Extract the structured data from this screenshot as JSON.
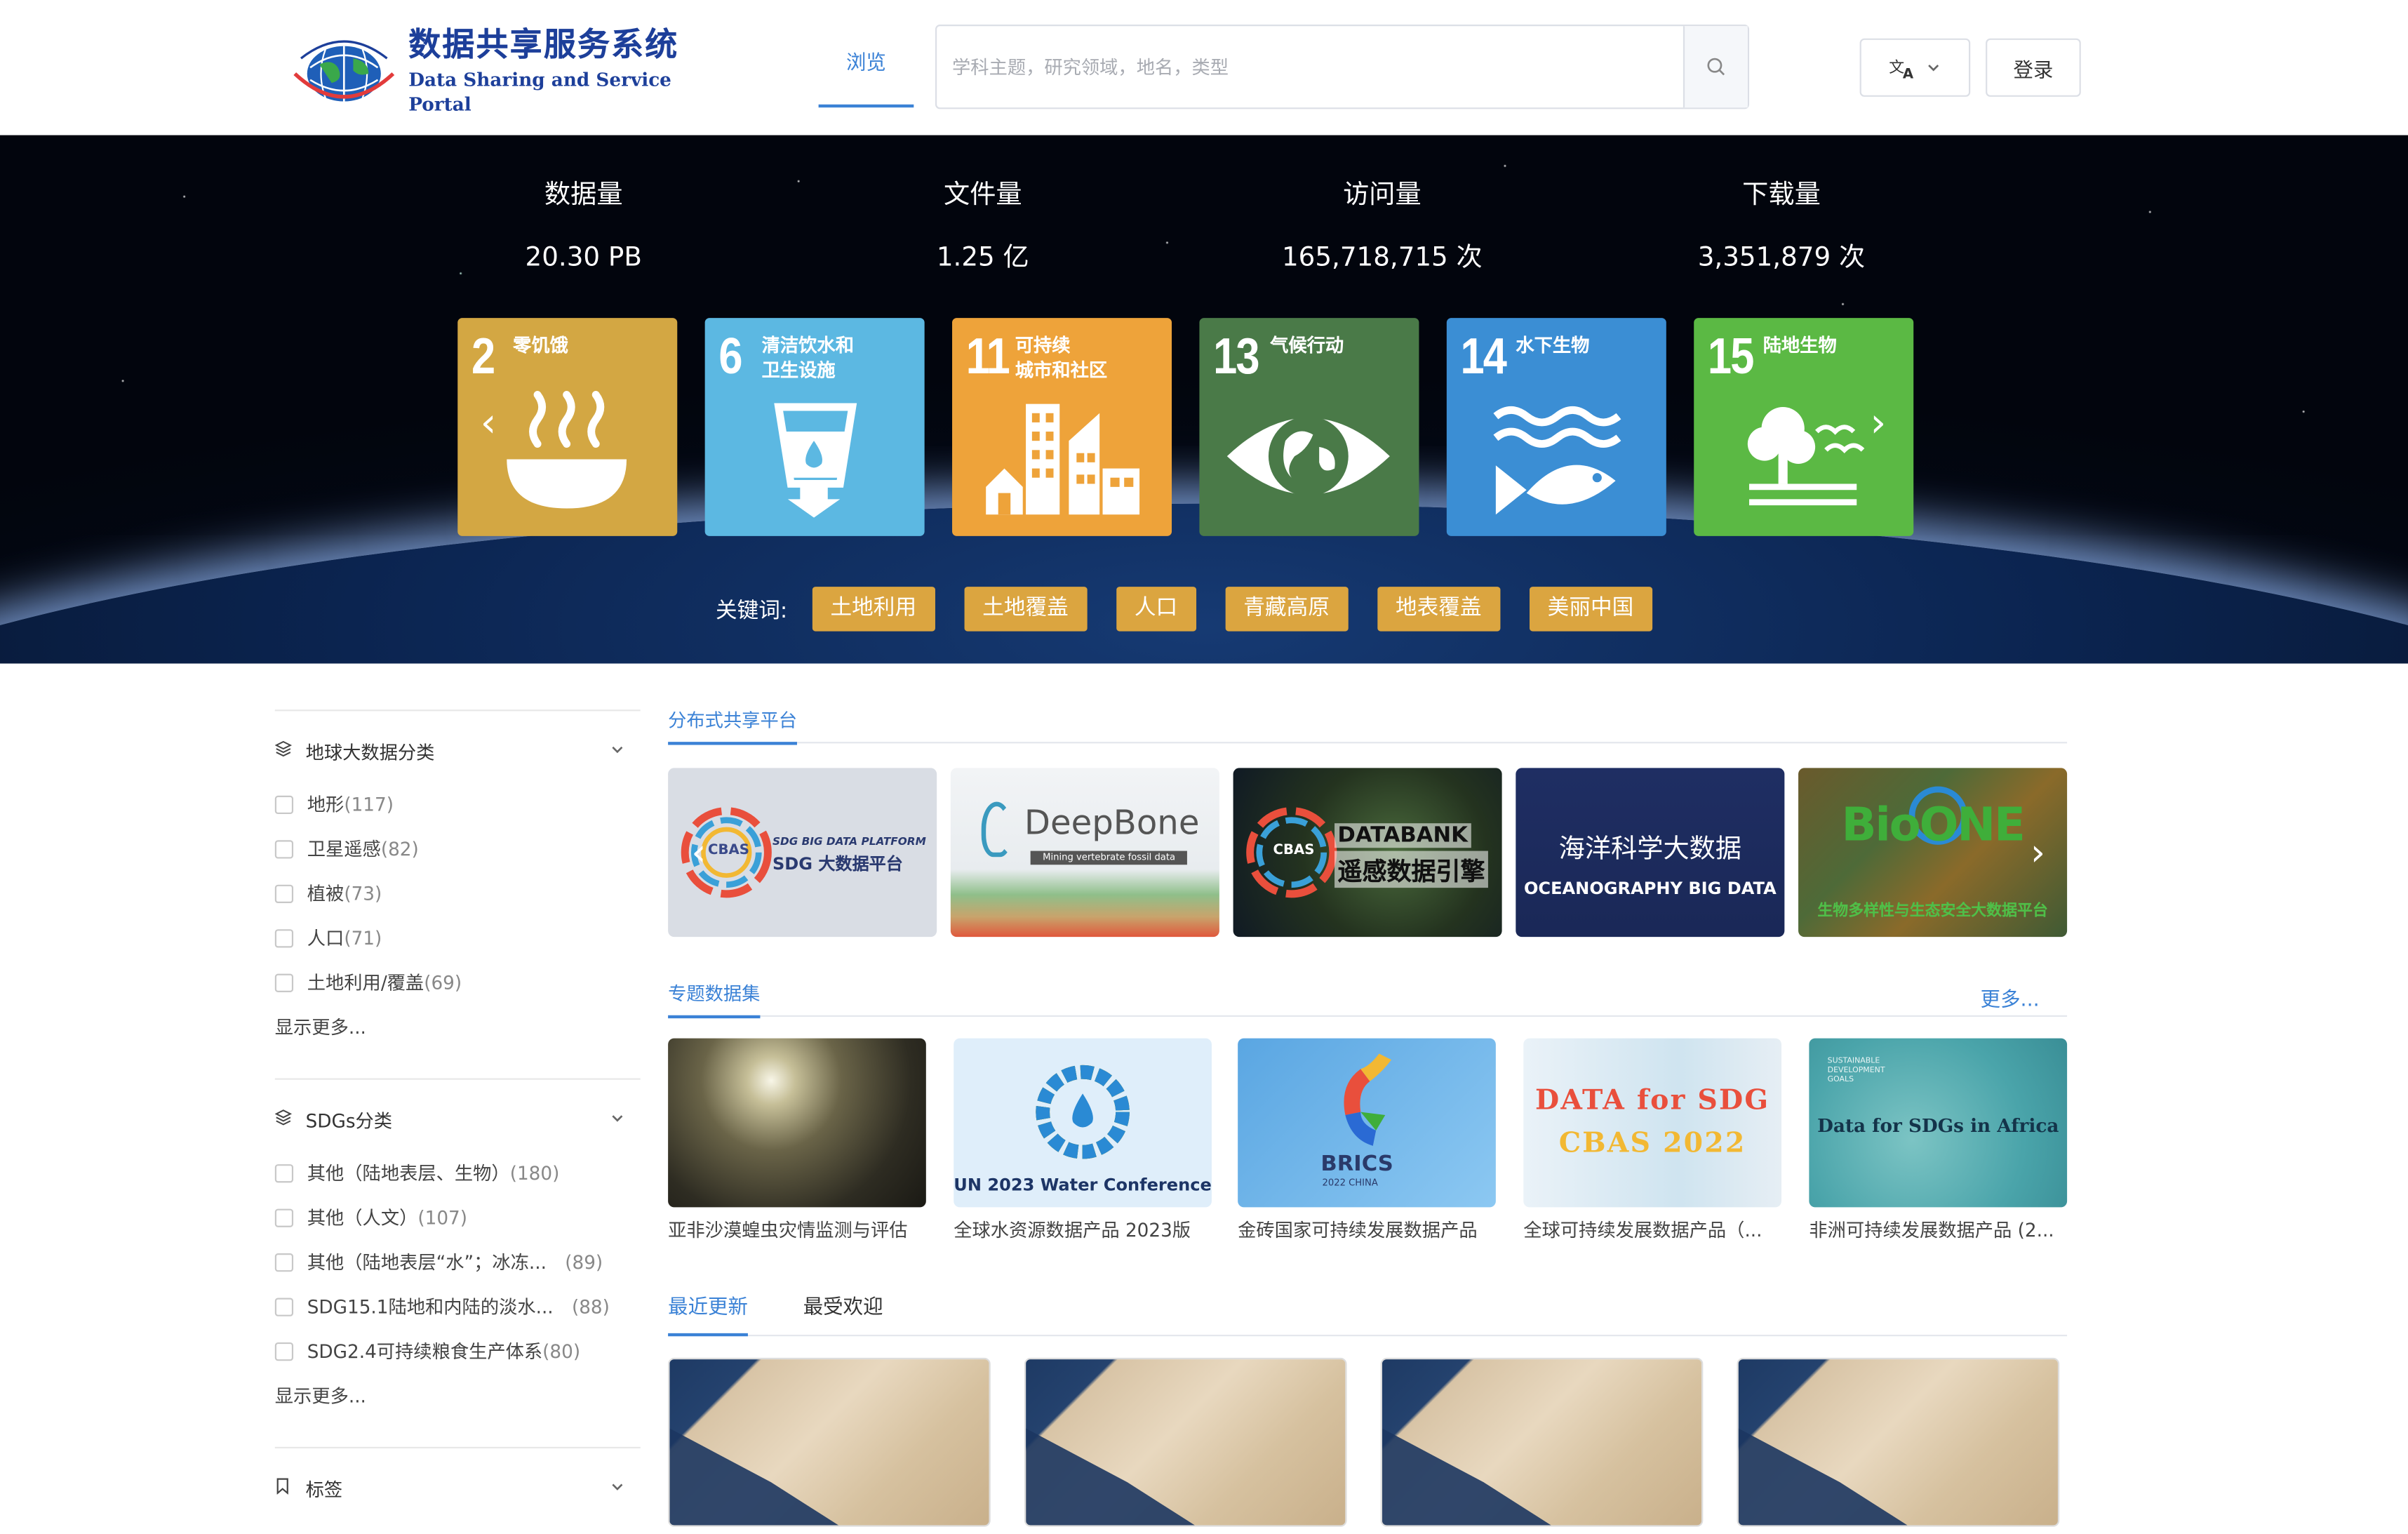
{
  "header": {
    "logo_cn": "数据共享服务系统",
    "logo_en": "Data Sharing and Service Portal",
    "nav_browse": "浏览",
    "search_placeholder": "学科主题，研究领域，地名，类型",
    "login": "登录",
    "lang_icon": "translate-icon"
  },
  "stats": [
    {
      "label": "数据量",
      "value": "20.30 PB"
    },
    {
      "label": "文件量",
      "value": "1.25 亿"
    },
    {
      "label": "访问量",
      "value": "165,718,715 次"
    },
    {
      "label": "下载量",
      "value": "3,351,879 次"
    }
  ],
  "sdgs": [
    {
      "num": "2",
      "title": "零饥饿",
      "color": "#d3a743"
    },
    {
      "num": "6",
      "title": "清洁饮水和\n卫生设施",
      "color": "#5cb8e2"
    },
    {
      "num": "11",
      "title": "可持续\n城市和社区",
      "color": "#eea33a"
    },
    {
      "num": "13",
      "title": "气候行动",
      "color": "#4a7a48"
    },
    {
      "num": "14",
      "title": "水下生物",
      "color": "#3b8ed4"
    },
    {
      "num": "15",
      "title": "陆地生物",
      "color": "#5bb944"
    }
  ],
  "keywords": {
    "label": "关键词:",
    "items": [
      "土地利用",
      "土地覆盖",
      "人口",
      "青藏高原",
      "地表覆盖",
      "美丽中国"
    ]
  },
  "sidebar": {
    "sections": [
      {
        "title": "地球大数据分类",
        "items": [
          {
            "name": "地形",
            "count": "(117)"
          },
          {
            "name": "卫星遥感",
            "count": "(82)"
          },
          {
            "name": "植被",
            "count": "(73)"
          },
          {
            "name": "人口",
            "count": "(71)"
          },
          {
            "name": "土地利用/覆盖",
            "count": "(69)"
          }
        ],
        "more": "显示更多..."
      },
      {
        "title": "SDGs分类",
        "items": [
          {
            "name": "其他（陆地表层、生物）",
            "count": "(180)"
          },
          {
            "name": "其他（人文）",
            "count": "(107)"
          },
          {
            "name": "其他（陆地表层“水”；冰冻...",
            "count": "(89)"
          },
          {
            "name": "SDG15.1陆地和内陆的淡水...",
            "count": "(88)"
          },
          {
            "name": "SDG2.4可持续粮食生产体系",
            "count": "(80)"
          }
        ],
        "more": "显示更多..."
      },
      {
        "title": "标签"
      }
    ]
  },
  "platforms": {
    "title": "分布式共享平台",
    "items": [
      {
        "line1": "SDG BIG DATA PLATFORM",
        "line2": "SDG 大数据平台",
        "badge": "CBAS"
      },
      {
        "line1": "DeepBone",
        "line2": "Mining vertebrate fossil data"
      },
      {
        "line1": "DATABANK",
        "line2": "遥感数据引擎",
        "badge": "CBAS"
      },
      {
        "line1": "海洋科学大数据",
        "line2": "OCEANOGRAPHY BIG DATA"
      },
      {
        "line1": "BioONE",
        "line2": "生物多样性与生态安全大数据平台"
      }
    ]
  },
  "datasets": {
    "title": "专题数据集",
    "more": "更多...",
    "items": [
      {
        "caption": "亚非沙漠蝗虫灾情监测与评估"
      },
      {
        "caption": "全球水资源数据产品 2023版",
        "img_text": "UN 2023 Water Conference"
      },
      {
        "caption": "金砖国家可持续发展数据产品",
        "img_text": "BRICS",
        "img_sub": "2022 CHINA"
      },
      {
        "caption": "全球可持续发展数据产品（...",
        "img_text": "DATA for SDG",
        "img_sub": "CBAS 2022"
      },
      {
        "caption": "非洲可持续发展数据产品 (2...",
        "img_text": "Data for SDGs in Africa",
        "img_sub": "SUSTAINABLE DEVELOPMENT GOALS"
      }
    ]
  },
  "tabs": {
    "recent": "最近更新",
    "popular": "最受欢迎"
  },
  "colors": {
    "accent": "#3b82d6",
    "keyword": "#dba540",
    "logo": "#1d3f9a"
  }
}
